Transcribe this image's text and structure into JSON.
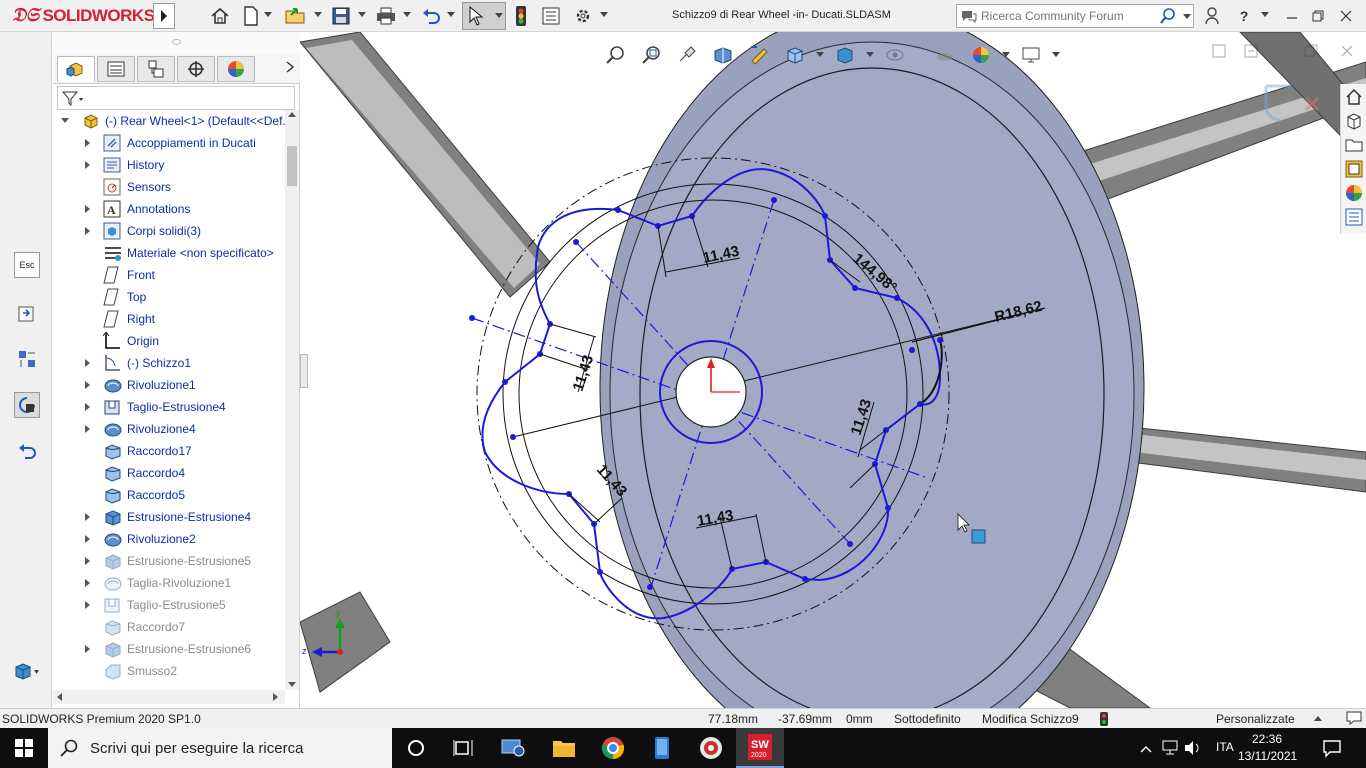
{
  "titlebar": {
    "brand": "SOLIDWORKS",
    "doc_title": "Schizzo9 di Rear Wheel -in- Ducati.SLDASM",
    "search_placeholder": "Ricerca Community Forum",
    "icons": [
      "home-icon",
      "new-doc-icon",
      "open-icon",
      "save-icon",
      "print-icon",
      "undo-icon",
      "select-icon",
      "rebuild-icon",
      "file-props-icon",
      "options-icon",
      "user-icon",
      "help-icon",
      "minimize-icon",
      "restore-icon",
      "close-icon"
    ]
  },
  "left_strip": {
    "esc_label": "Esc"
  },
  "feature_manager": {
    "root": "(-) Rear Wheel<1> (Default<<Def...",
    "items": [
      {
        "label": "Accoppiamenti in Ducati",
        "icon": "mates-icon",
        "expandable": true,
        "gray": false
      },
      {
        "label": "History",
        "icon": "history-icon",
        "expandable": true,
        "gray": false
      },
      {
        "label": "Sensors",
        "icon": "sensors-icon",
        "expandable": false,
        "gray": false
      },
      {
        "label": "Annotations",
        "icon": "annotations-icon",
        "expandable": true,
        "gray": false
      },
      {
        "label": "Corpi solidi(3)",
        "icon": "solid-bodies-icon",
        "expandable": true,
        "gray": false
      },
      {
        "label": "Materiale <non specificato>",
        "icon": "material-icon",
        "expandable": false,
        "gray": false
      },
      {
        "label": "Front",
        "icon": "plane-icon",
        "expandable": false,
        "gray": false
      },
      {
        "label": "Top",
        "icon": "plane-icon",
        "expandable": false,
        "gray": false
      },
      {
        "label": "Right",
        "icon": "plane-icon",
        "expandable": false,
        "gray": false
      },
      {
        "label": "Origin",
        "icon": "origin-icon",
        "expandable": false,
        "gray": false
      },
      {
        "label": "(-) Schizzo1",
        "icon": "sketch-icon",
        "expandable": true,
        "gray": false
      },
      {
        "label": "Rivoluzione1",
        "icon": "revolve-icon",
        "expandable": true,
        "gray": false
      },
      {
        "label": "Taglio-Estrusione4",
        "icon": "cut-extrude-icon",
        "expandable": true,
        "gray": false
      },
      {
        "label": "Rivoluzione4",
        "icon": "revolve-icon",
        "expandable": true,
        "gray": false
      },
      {
        "label": "Raccordo17",
        "icon": "fillet-icon",
        "expandable": false,
        "gray": false
      },
      {
        "label": "Raccordo4",
        "icon": "fillet-icon",
        "expandable": false,
        "gray": false
      },
      {
        "label": "Raccordo5",
        "icon": "fillet-icon",
        "expandable": false,
        "gray": false
      },
      {
        "label": "Estrusione-Estrusione4",
        "icon": "extrude-icon",
        "expandable": true,
        "gray": false
      },
      {
        "label": "Rivoluzione2",
        "icon": "revolve-icon",
        "expandable": true,
        "gray": false
      },
      {
        "label": "Estrusione-Estrusione5",
        "icon": "extrude-icon",
        "expandable": true,
        "gray": true
      },
      {
        "label": "Taglia-Rivoluzione1",
        "icon": "cut-revolve-icon",
        "expandable": true,
        "gray": true
      },
      {
        "label": "Taglio-Estrusione5",
        "icon": "cut-extrude-icon",
        "expandable": true,
        "gray": true
      },
      {
        "label": "Raccordo7",
        "icon": "fillet-icon",
        "expandable": false,
        "gray": true
      },
      {
        "label": "Estrusione-Estrusione6",
        "icon": "extrude-icon",
        "expandable": true,
        "gray": true
      },
      {
        "label": "Smusso2",
        "icon": "chamfer-icon",
        "expandable": false,
        "gray": true
      }
    ]
  },
  "sketch": {
    "dimensions": [
      {
        "text": "11,43",
        "name": "dim-top"
      },
      {
        "text": "11,43",
        "name": "dim-left"
      },
      {
        "text": "11,43",
        "name": "dim-right"
      },
      {
        "text": "11,43",
        "name": "dim-lower-left"
      },
      {
        "text": "11,43",
        "name": "dim-bottom"
      },
      {
        "text": "144,98°",
        "name": "dim-angle"
      },
      {
        "text": "R18,62",
        "name": "dim-radius"
      }
    ],
    "triad_x": "x",
    "triad_y": "y",
    "triad_z": "z"
  },
  "statusbar": {
    "product": "SOLIDWORKS Premium 2020 SP1.0",
    "x": "77.18mm",
    "y": "-37.69mm",
    "z": "0mm",
    "state": "Sottodefinito",
    "mode": "Modifica Schizzo9",
    "units": "Personalizzate"
  },
  "taskbar": {
    "search_text": "Scrivi qui per eseguire la ricerca",
    "lang": "ITA",
    "time": "22:36",
    "date": "13/11/2021",
    "apps": [
      "cortana-icon",
      "task-view-icon",
      "network-app-icon",
      "file-explorer-icon",
      "chrome-icon",
      "phone-app-icon",
      "media-icon",
      "solidworks-app-icon"
    ]
  },
  "colors": {
    "disc": "#a4abc7",
    "disc_edge": "#8f96b4",
    "sketch_blue": "#1a1ad9",
    "spoke": "#707070"
  }
}
